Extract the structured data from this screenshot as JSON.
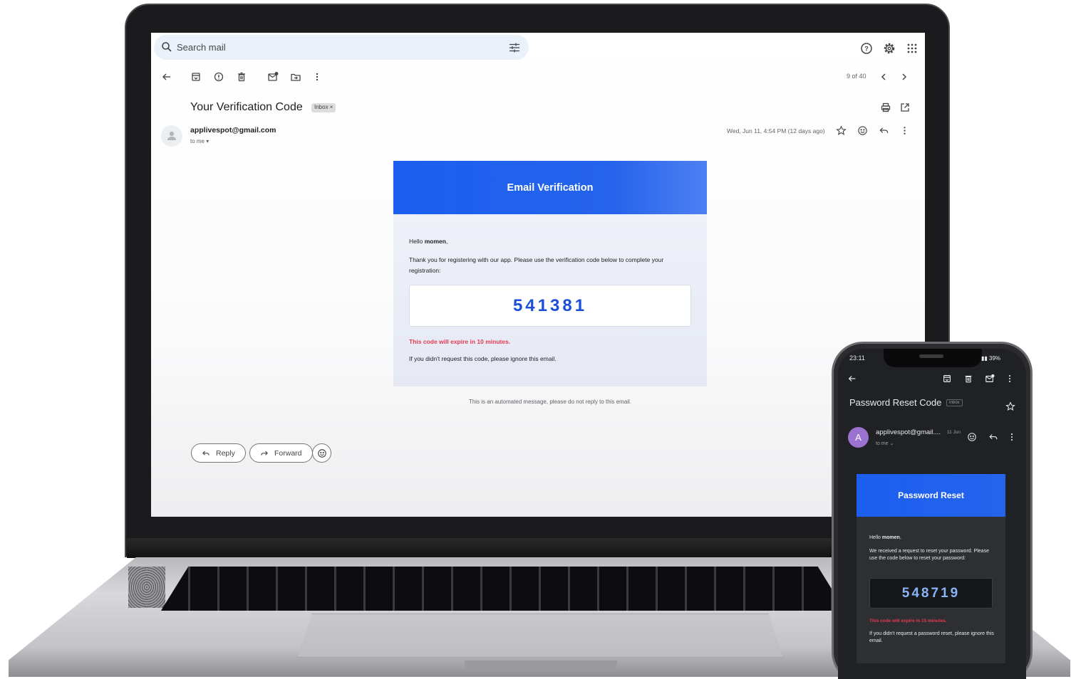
{
  "laptop": {
    "search": {
      "placeholder": "Search mail"
    },
    "toolbar": {
      "pagination": "9 of 40"
    },
    "message": {
      "subject": "Your Verification Code",
      "label_chip": "Inbox ×",
      "sender": "applivespot@gmail.com",
      "recipient": "to me",
      "date": "Wed, Jun 11, 4:54 PM (12 days ago)"
    },
    "email_card": {
      "header": "Email Verification",
      "greeting_prefix": "Hello ",
      "greeting_name": "momen",
      "greeting_suffix": ",",
      "body": "Thank you for registering with our app. Please use the verification code below to complete your registration:",
      "code": "541381",
      "expiry": "This code will expire in 10 minutes.",
      "ignore": "If you didn't request this code, please ignore this email.",
      "footer": "This is an automated message, please do not reply to this email."
    },
    "actions": {
      "reply": "Reply",
      "forward": "Forward"
    }
  },
  "phone": {
    "status": {
      "time": "23:11",
      "battery": "39%"
    },
    "message": {
      "subject": "Password Reset Code",
      "label_chip": "Inbox",
      "avatar_letter": "A",
      "sender": "applivespot@gmail....",
      "date": "11 Jun",
      "recipient": "to me"
    },
    "email_card": {
      "header": "Password Reset",
      "greeting_prefix": "Hello ",
      "greeting_name": "momen",
      "greeting_suffix": ",",
      "body": "We received a request to reset your password. Please use the code below to reset your password:",
      "code": "548719",
      "expiry": "This code will expire in 15 minutes.",
      "ignore": "If you didn't request a password reset, please ignore this email."
    }
  },
  "colors": {
    "accent": "#1b5ff0",
    "code_light": "#1b4fd8",
    "code_dark": "#8ab4f8",
    "warning": "#e53950"
  },
  "icons": [
    "search-icon",
    "tune-icon",
    "help-icon",
    "settings-icon",
    "apps-icon",
    "back-arrow-icon",
    "archive-icon",
    "report-spam-icon",
    "delete-icon",
    "mark-unread-icon",
    "move-to-icon",
    "more-vert-icon",
    "chevron-left-icon",
    "chevron-right-icon",
    "print-icon",
    "open-new-window-icon",
    "star-icon",
    "emoji-icon",
    "reply-icon",
    "forward-icon"
  ]
}
